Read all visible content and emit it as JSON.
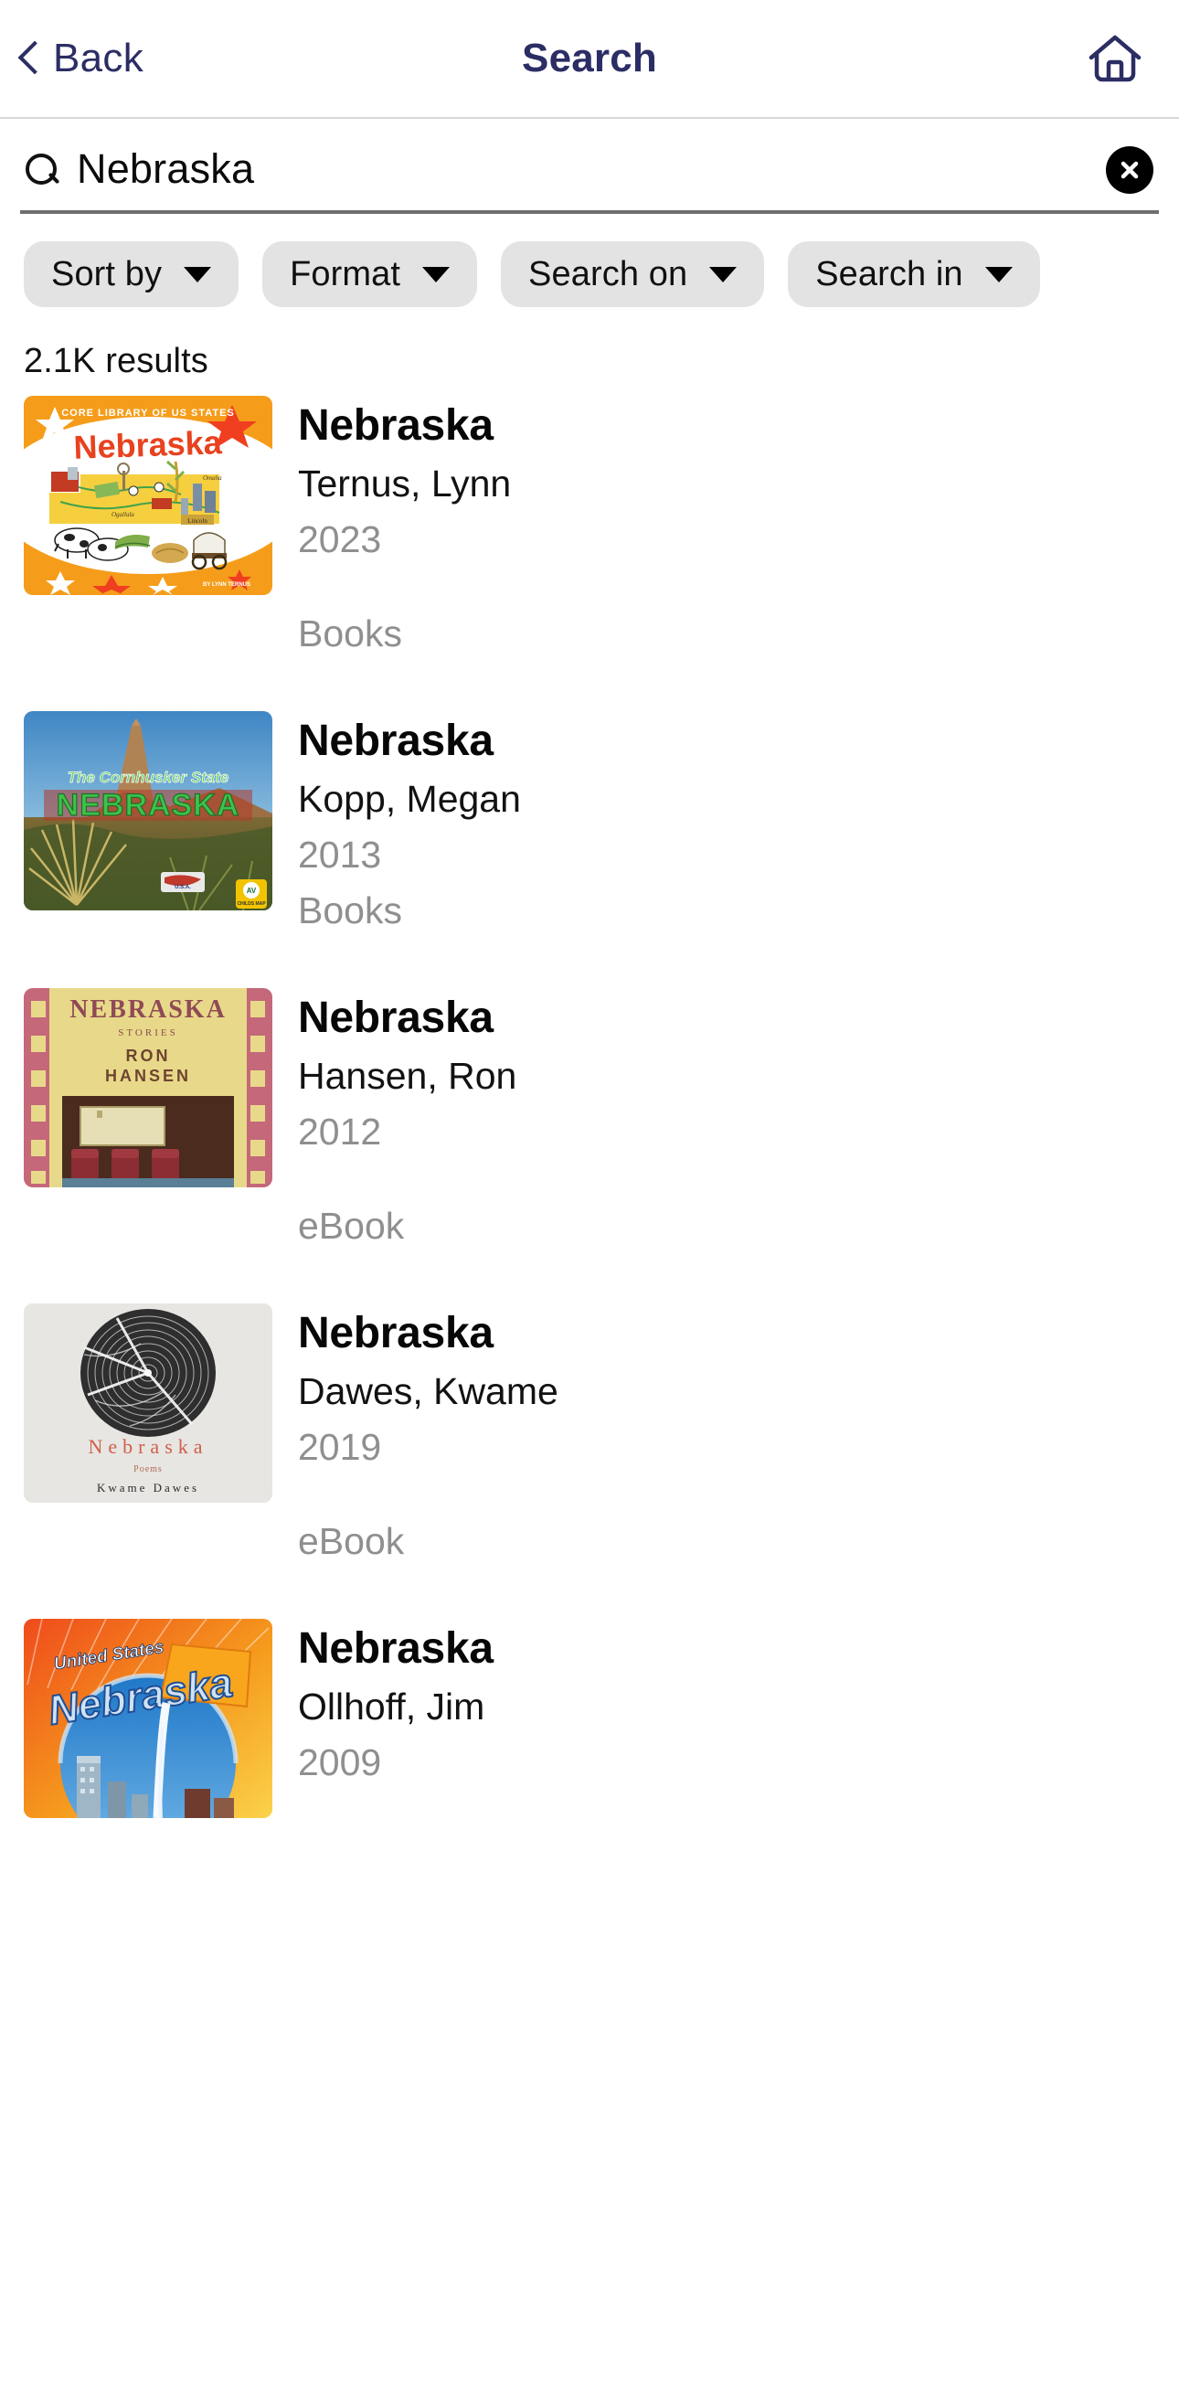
{
  "navbar": {
    "back_label": "Back",
    "title": "Search",
    "home_icon": "home-icon",
    "back_icon": "chevron-left-icon",
    "accent_color": "#2b2d64"
  },
  "search": {
    "icon": "search-icon",
    "value": "Nebraska",
    "placeholder": "Search",
    "clear_icon": "clear-circle-icon"
  },
  "filters": [
    {
      "label": "Sort by",
      "icon": "chevron-down-icon"
    },
    {
      "label": "Format",
      "icon": "chevron-down-icon"
    },
    {
      "label": "Search on",
      "icon": "chevron-down-icon"
    },
    {
      "label": "Search in",
      "icon": "chevron-down-icon"
    }
  ],
  "results_count": "2.1K results",
  "results": [
    {
      "title": "Nebraska",
      "author": "Ternus, Lynn",
      "year": "2023",
      "format": "Books",
      "cover": {
        "id": "cover-core-library-nebraska",
        "style": "orange-map",
        "band_color": "#f59d1a",
        "title_color": "#e8421f",
        "top_text": "CORE LIBRARY OF US STATES",
        "main_text": "Nebraska",
        "bottom_text": "BY LYNN TERNUS"
      }
    },
    {
      "title": "Nebraska",
      "author": "Kopp, Megan",
      "year": "2013",
      "format": "Books",
      "cover": {
        "id": "cover-cornhusker-state",
        "style": "chimney-rock-photo",
        "sky_color": "#5a9fd4",
        "title_color": "#3fb84f",
        "top_text": "The Cornhusker State",
        "main_text": "NEBRASKA"
      }
    },
    {
      "title": "Nebraska",
      "author": "Hansen, Ron",
      "year": "2012",
      "format": "eBook",
      "cover": {
        "id": "cover-nebraska-stories",
        "style": "yellow-filmstrip",
        "frame_color": "#c4687a",
        "panel_color": "#e8d98a",
        "main_text": "NEBRASKA",
        "sub_text": "STORIES",
        "author_text_1": "RON",
        "author_text_2": "HANSEN"
      }
    },
    {
      "title": "Nebraska",
      "author": "Dawes, Kwame",
      "year": "2019",
      "format": "eBook",
      "cover": {
        "id": "cover-nebraska-poems",
        "style": "gray-spiral",
        "bg_color": "#e6e6e4",
        "main_text": "Nebraska",
        "title_color": "#d1614a",
        "sub_text": "Poems",
        "author_text": "Kwame Dawes"
      }
    },
    {
      "title": "Nebraska",
      "author": "Ollhoff, Jim",
      "year": "2009",
      "format": "",
      "cover": {
        "id": "cover-united-states-nebraska",
        "style": "orange-blue-fountain",
        "bg_color": "#ee5a1f",
        "top_text": "United States",
        "main_text": "Nebraska"
      }
    }
  ]
}
